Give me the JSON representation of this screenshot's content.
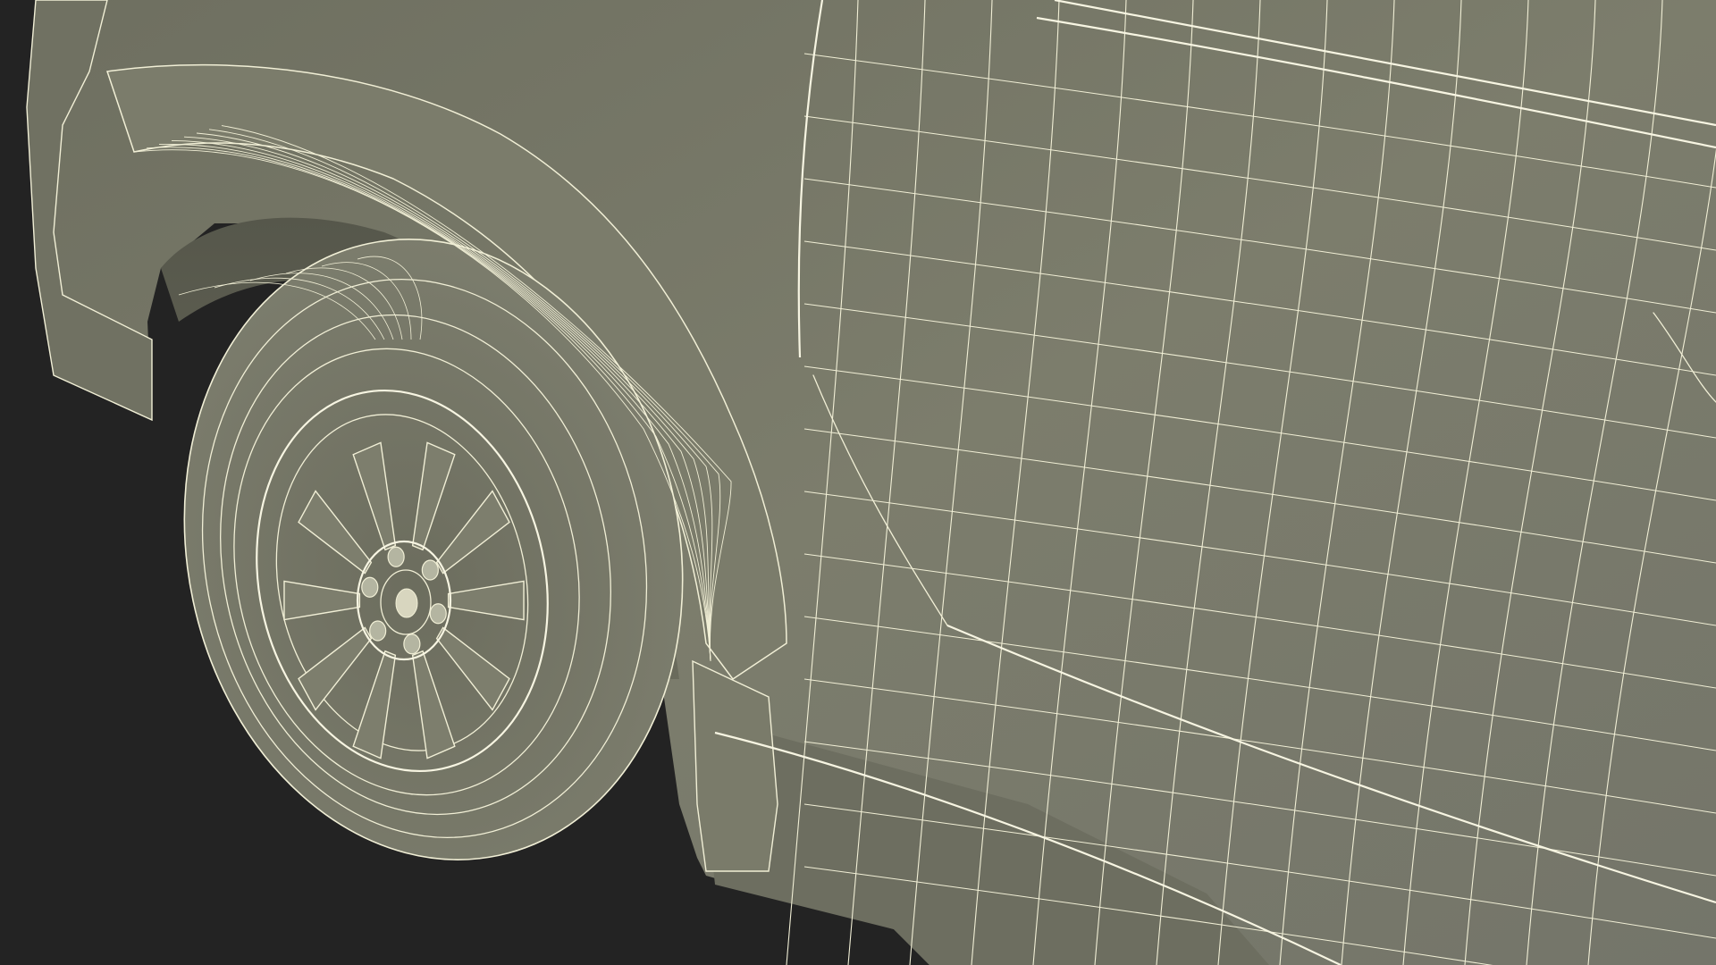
{
  "scene": {
    "background_color": "#232323",
    "surface_color": "#7a7b6a",
    "surface_shadow_color": "#5f6152",
    "wire_color": "#f1efd6"
  }
}
